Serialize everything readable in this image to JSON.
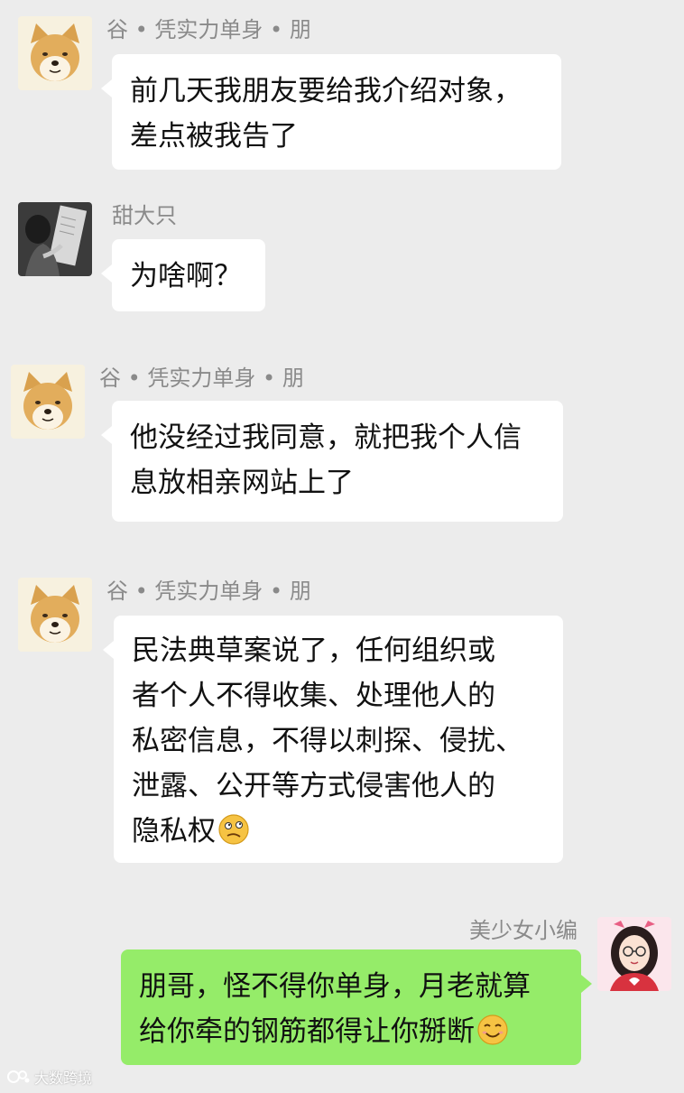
{
  "messages": [
    {
      "sender": "谷 • 凭实力单身 • 朋",
      "avatar_icon": "shiba-dog-avatar",
      "lines": [
        "前几天我朋友要给我介绍对象，",
        "差点被我告了"
      ]
    },
    {
      "sender": "甜大只",
      "avatar_icon": "woman-reading-avatar",
      "lines": [
        "为啥啊？"
      ]
    },
    {
      "sender": "谷 • 凭实力单身 • 朋",
      "avatar_icon": "shiba-dog-avatar",
      "lines": [
        "他没经过我同意，就把我个人信",
        "息放相亲网站上了"
      ]
    },
    {
      "sender": "谷 • 凭实力单身 • 朋",
      "avatar_icon": "shiba-dog-avatar",
      "lines": [
        "民法典草案说了，任何组织或",
        "者个人不得收集、处理他人的",
        "私密信息，不得以刺探、侵扰、",
        "泄露、公开等方式侵害他人的",
        "隐私权"
      ],
      "trailing_emoji": "confused-emoji"
    },
    {
      "sender": "美少女小编",
      "avatar_icon": "girl-glasses-avatar",
      "lines": [
        "朋哥，怪不得你单身，月老就算",
        "给你牵的钢筋都得让你掰断"
      ],
      "trailing_emoji": "smile-emoji"
    }
  ],
  "watermark": "大数跨境",
  "colors": {
    "background": "#ececec",
    "bubble_left": "#ffffff",
    "bubble_right": "#95ec69",
    "name_text": "#8a8a8a"
  }
}
